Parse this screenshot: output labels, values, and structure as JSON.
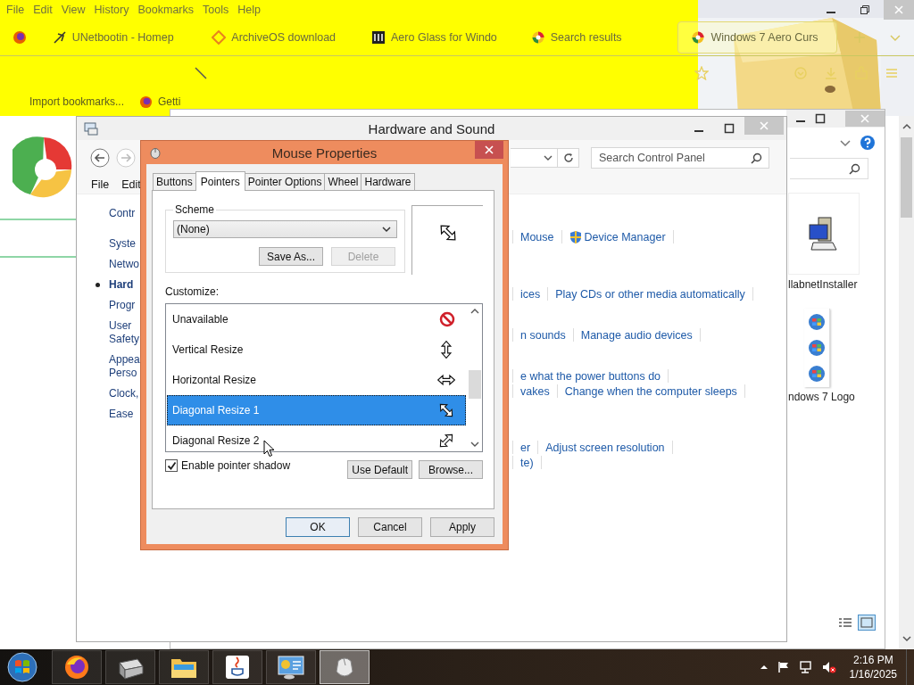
{
  "browser": {
    "menu": [
      "File",
      "Edit",
      "View",
      "History",
      "Bookmarks",
      "Tools",
      "Help"
    ],
    "tabs": [
      {
        "label": "UNetbootin - Homep",
        "kind": "plane",
        "selected": false
      },
      {
        "label": "ArchiveOS download",
        "kind": "diamond",
        "selected": false
      },
      {
        "label": "Aero Glass for Windo",
        "kind": "building",
        "selected": false
      },
      {
        "label": "Search results",
        "kind": "swirl",
        "selected": false
      },
      {
        "label": "Windows 7 Aero Curs",
        "kind": "swirl",
        "selected": true
      }
    ],
    "bookmarks": [
      "Import bookmarks...",
      "Getti"
    ]
  },
  "back_window": {
    "items": [
      {
        "label": "llabnetInstaller",
        "kind": "computer"
      },
      {
        "label": "ndows 7 Logo",
        "kind": "orbs"
      }
    ]
  },
  "control_panel": {
    "title": "Hardware and Sound",
    "search": {
      "placeholder": "Search Control Panel"
    },
    "menu": [
      "File",
      "Edit"
    ],
    "nav": [
      {
        "lines": [
          "Contr"
        ],
        "selected": false
      },
      {
        "lines": [
          "Syste"
        ],
        "selected": false
      },
      {
        "lines": [
          "Netwo"
        ],
        "selected": false
      },
      {
        "lines": [
          "Hard"
        ],
        "selected": true
      },
      {
        "lines": [
          "Progr"
        ],
        "selected": false
      },
      {
        "lines": [
          "User",
          "Safety"
        ],
        "selected": false
      },
      {
        "lines": [
          "Appea",
          "Perso"
        ],
        "selected": false
      },
      {
        "lines": [
          "Clock,"
        ],
        "selected": false
      },
      {
        "lines": [
          "Ease"
        ],
        "selected": false
      }
    ],
    "link_groups": [
      [
        [
          {
            "text": "Mouse",
            "shield": false
          },
          {
            "text": "Device Manager",
            "shield": true
          }
        ]
      ],
      [
        [
          {
            "text": "ices",
            "shield": false
          },
          {
            "text": "Play CDs or other media automatically",
            "shield": false
          }
        ]
      ],
      [
        [
          {
            "text": "n sounds",
            "shield": false
          },
          {
            "text": "Manage audio devices",
            "shield": false
          }
        ]
      ],
      [
        [
          {
            "text": "e what the power buttons do",
            "shield": false
          }
        ],
        [
          {
            "text": "vakes",
            "shield": false
          },
          {
            "text": "Change when the computer sleeps",
            "shield": false
          }
        ]
      ],
      [
        [
          {
            "text": "er",
            "shield": false
          },
          {
            "text": "Adjust screen resolution",
            "shield": false
          }
        ],
        [
          {
            "text": "te)",
            "shield": false
          }
        ]
      ]
    ]
  },
  "dialog": {
    "title": "Mouse Properties",
    "tabs": [
      {
        "label": "Buttons",
        "selected": false
      },
      {
        "label": "Pointers",
        "selected": true
      },
      {
        "label": "Pointer Options",
        "selected": false
      },
      {
        "label": "Wheel",
        "selected": false
      },
      {
        "label": "Hardware",
        "selected": false
      }
    ],
    "scheme": {
      "label": "Scheme",
      "value": "(None)"
    },
    "scheme_buttons": [
      {
        "label": "Save As...",
        "disabled": false
      },
      {
        "label": "Delete",
        "disabled": true
      }
    ],
    "customize_label": "Customize:",
    "pointers": [
      {
        "name": "Unavailable",
        "kind": "unavailable",
        "selected": false
      },
      {
        "name": "Vertical Resize",
        "kind": "vertical",
        "selected": false
      },
      {
        "name": "Horizontal Resize",
        "kind": "horizontal",
        "selected": false
      },
      {
        "name": "Diagonal Resize 1",
        "kind": "diagonal1",
        "selected": true
      },
      {
        "name": "Diagonal Resize 2",
        "kind": "diagonal2",
        "selected": false
      }
    ],
    "shadow": {
      "label": "Enable pointer shadow",
      "checked": true
    },
    "list_buttons": [
      "Use Default",
      "Browse..."
    ],
    "buttons": [
      {
        "label": "OK",
        "default": true
      },
      {
        "label": "Cancel",
        "default": false
      },
      {
        "label": "Apply",
        "default": false
      }
    ]
  },
  "taskbar": {
    "apps": [
      {
        "kind": "firefox",
        "selected": false
      },
      {
        "kind": "scanner",
        "selected": false
      },
      {
        "kind": "folder",
        "selected": false
      },
      {
        "kind": "java",
        "selected": false
      },
      {
        "kind": "control-panel",
        "selected": false
      },
      {
        "kind": "mouse",
        "selected": true
      }
    ],
    "time": "2:16 PM",
    "date": "1/16/2025"
  }
}
